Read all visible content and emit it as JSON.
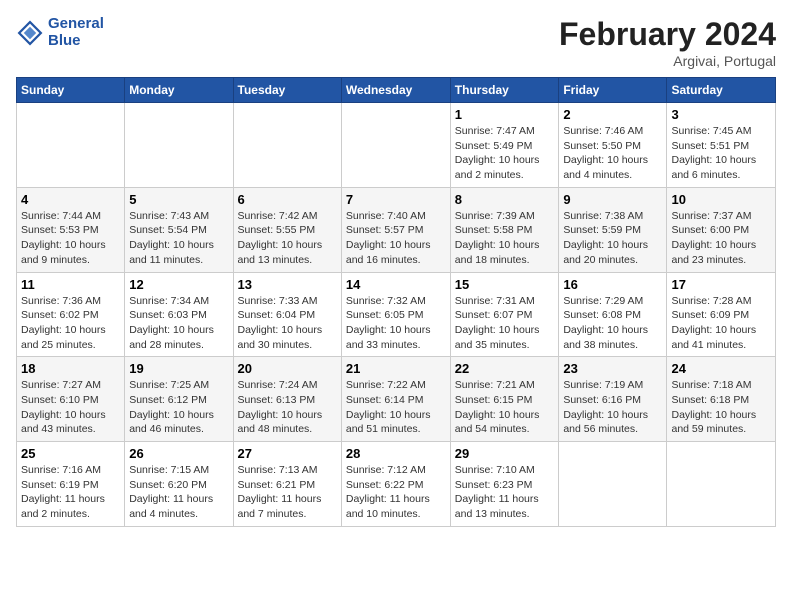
{
  "header": {
    "logo_line1": "General",
    "logo_line2": "Blue",
    "title": "February 2024",
    "subtitle": "Argivai, Portugal"
  },
  "weekdays": [
    "Sunday",
    "Monday",
    "Tuesday",
    "Wednesday",
    "Thursday",
    "Friday",
    "Saturday"
  ],
  "weeks": [
    [
      {
        "day": "",
        "info": ""
      },
      {
        "day": "",
        "info": ""
      },
      {
        "day": "",
        "info": ""
      },
      {
        "day": "",
        "info": ""
      },
      {
        "day": "1",
        "info": "Sunrise: 7:47 AM\nSunset: 5:49 PM\nDaylight: 10 hours\nand 2 minutes."
      },
      {
        "day": "2",
        "info": "Sunrise: 7:46 AM\nSunset: 5:50 PM\nDaylight: 10 hours\nand 4 minutes."
      },
      {
        "day": "3",
        "info": "Sunrise: 7:45 AM\nSunset: 5:51 PM\nDaylight: 10 hours\nand 6 minutes."
      }
    ],
    [
      {
        "day": "4",
        "info": "Sunrise: 7:44 AM\nSunset: 5:53 PM\nDaylight: 10 hours\nand 9 minutes."
      },
      {
        "day": "5",
        "info": "Sunrise: 7:43 AM\nSunset: 5:54 PM\nDaylight: 10 hours\nand 11 minutes."
      },
      {
        "day": "6",
        "info": "Sunrise: 7:42 AM\nSunset: 5:55 PM\nDaylight: 10 hours\nand 13 minutes."
      },
      {
        "day": "7",
        "info": "Sunrise: 7:40 AM\nSunset: 5:57 PM\nDaylight: 10 hours\nand 16 minutes."
      },
      {
        "day": "8",
        "info": "Sunrise: 7:39 AM\nSunset: 5:58 PM\nDaylight: 10 hours\nand 18 minutes."
      },
      {
        "day": "9",
        "info": "Sunrise: 7:38 AM\nSunset: 5:59 PM\nDaylight: 10 hours\nand 20 minutes."
      },
      {
        "day": "10",
        "info": "Sunrise: 7:37 AM\nSunset: 6:00 PM\nDaylight: 10 hours\nand 23 minutes."
      }
    ],
    [
      {
        "day": "11",
        "info": "Sunrise: 7:36 AM\nSunset: 6:02 PM\nDaylight: 10 hours\nand 25 minutes."
      },
      {
        "day": "12",
        "info": "Sunrise: 7:34 AM\nSunset: 6:03 PM\nDaylight: 10 hours\nand 28 minutes."
      },
      {
        "day": "13",
        "info": "Sunrise: 7:33 AM\nSunset: 6:04 PM\nDaylight: 10 hours\nand 30 minutes."
      },
      {
        "day": "14",
        "info": "Sunrise: 7:32 AM\nSunset: 6:05 PM\nDaylight: 10 hours\nand 33 minutes."
      },
      {
        "day": "15",
        "info": "Sunrise: 7:31 AM\nSunset: 6:07 PM\nDaylight: 10 hours\nand 35 minutes."
      },
      {
        "day": "16",
        "info": "Sunrise: 7:29 AM\nSunset: 6:08 PM\nDaylight: 10 hours\nand 38 minutes."
      },
      {
        "day": "17",
        "info": "Sunrise: 7:28 AM\nSunset: 6:09 PM\nDaylight: 10 hours\nand 41 minutes."
      }
    ],
    [
      {
        "day": "18",
        "info": "Sunrise: 7:27 AM\nSunset: 6:10 PM\nDaylight: 10 hours\nand 43 minutes."
      },
      {
        "day": "19",
        "info": "Sunrise: 7:25 AM\nSunset: 6:12 PM\nDaylight: 10 hours\nand 46 minutes."
      },
      {
        "day": "20",
        "info": "Sunrise: 7:24 AM\nSunset: 6:13 PM\nDaylight: 10 hours\nand 48 minutes."
      },
      {
        "day": "21",
        "info": "Sunrise: 7:22 AM\nSunset: 6:14 PM\nDaylight: 10 hours\nand 51 minutes."
      },
      {
        "day": "22",
        "info": "Sunrise: 7:21 AM\nSunset: 6:15 PM\nDaylight: 10 hours\nand 54 minutes."
      },
      {
        "day": "23",
        "info": "Sunrise: 7:19 AM\nSunset: 6:16 PM\nDaylight: 10 hours\nand 56 minutes."
      },
      {
        "day": "24",
        "info": "Sunrise: 7:18 AM\nSunset: 6:18 PM\nDaylight: 10 hours\nand 59 minutes."
      }
    ],
    [
      {
        "day": "25",
        "info": "Sunrise: 7:16 AM\nSunset: 6:19 PM\nDaylight: 11 hours\nand 2 minutes."
      },
      {
        "day": "26",
        "info": "Sunrise: 7:15 AM\nSunset: 6:20 PM\nDaylight: 11 hours\nand 4 minutes."
      },
      {
        "day": "27",
        "info": "Sunrise: 7:13 AM\nSunset: 6:21 PM\nDaylight: 11 hours\nand 7 minutes."
      },
      {
        "day": "28",
        "info": "Sunrise: 7:12 AM\nSunset: 6:22 PM\nDaylight: 11 hours\nand 10 minutes."
      },
      {
        "day": "29",
        "info": "Sunrise: 7:10 AM\nSunset: 6:23 PM\nDaylight: 11 hours\nand 13 minutes."
      },
      {
        "day": "",
        "info": ""
      },
      {
        "day": "",
        "info": ""
      }
    ]
  ]
}
